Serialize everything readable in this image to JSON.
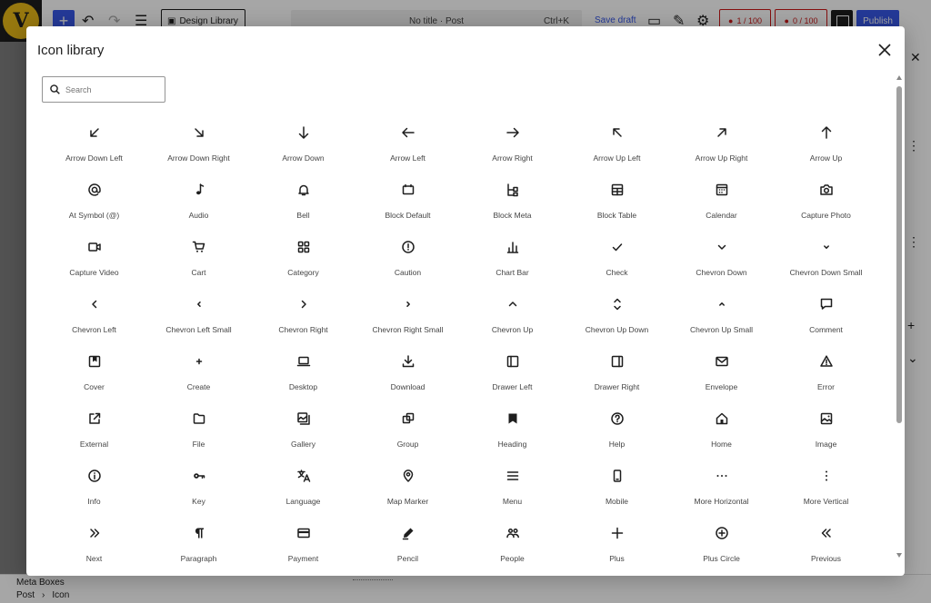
{
  "toolbar": {
    "design_library_label": "Design Library",
    "document_title": "No title · Post",
    "shortcut": "Ctrl+K",
    "save_draft": "Save draft",
    "score_readability": "1 / 100",
    "score_seo": "0 / 100",
    "publish": "Publish"
  },
  "modal": {
    "title": "Icon library",
    "search_placeholder": "Search",
    "icons": [
      {
        "label": "Arrow Down Left",
        "icon": "arrow-down-left"
      },
      {
        "label": "Arrow Down Right",
        "icon": "arrow-down-right"
      },
      {
        "label": "Arrow Down",
        "icon": "arrow-down"
      },
      {
        "label": "Arrow Left",
        "icon": "arrow-left"
      },
      {
        "label": "Arrow Right",
        "icon": "arrow-right"
      },
      {
        "label": "Arrow Up Left",
        "icon": "arrow-up-left"
      },
      {
        "label": "Arrow Up Right",
        "icon": "arrow-up-right"
      },
      {
        "label": "Arrow Up",
        "icon": "arrow-up"
      },
      {
        "label": "At Symbol (@)",
        "icon": "at-symbol"
      },
      {
        "label": "Audio",
        "icon": "audio"
      },
      {
        "label": "Bell",
        "icon": "bell"
      },
      {
        "label": "Block Default",
        "icon": "block-default"
      },
      {
        "label": "Block Meta",
        "icon": "block-meta"
      },
      {
        "label": "Block Table",
        "icon": "block-table"
      },
      {
        "label": "Calendar",
        "icon": "calendar"
      },
      {
        "label": "Capture Photo",
        "icon": "capture-photo"
      },
      {
        "label": "Capture Video",
        "icon": "capture-video"
      },
      {
        "label": "Cart",
        "icon": "cart"
      },
      {
        "label": "Category",
        "icon": "category"
      },
      {
        "label": "Caution",
        "icon": "caution"
      },
      {
        "label": "Chart Bar",
        "icon": "chart-bar"
      },
      {
        "label": "Check",
        "icon": "check"
      },
      {
        "label": "Chevron Down",
        "icon": "chevron-down"
      },
      {
        "label": "Chevron Down Small",
        "icon": "chevron-down-small"
      },
      {
        "label": "Chevron Left",
        "icon": "chevron-left"
      },
      {
        "label": "Chevron Left Small",
        "icon": "chevron-left-small"
      },
      {
        "label": "Chevron Right",
        "icon": "chevron-right"
      },
      {
        "label": "Chevron Right Small",
        "icon": "chevron-right-small"
      },
      {
        "label": "Chevron Up",
        "icon": "chevron-up"
      },
      {
        "label": "Chevron Up Down",
        "icon": "chevron-up-down"
      },
      {
        "label": "Chevron Up Small",
        "icon": "chevron-up-small"
      },
      {
        "label": "Comment",
        "icon": "comment"
      },
      {
        "label": "Cover",
        "icon": "cover"
      },
      {
        "label": "Create",
        "icon": "create"
      },
      {
        "label": "Desktop",
        "icon": "desktop"
      },
      {
        "label": "Download",
        "icon": "download"
      },
      {
        "label": "Drawer Left",
        "icon": "drawer-left"
      },
      {
        "label": "Drawer Right",
        "icon": "drawer-right"
      },
      {
        "label": "Envelope",
        "icon": "envelope"
      },
      {
        "label": "Error",
        "icon": "error"
      },
      {
        "label": "External",
        "icon": "external"
      },
      {
        "label": "File",
        "icon": "file"
      },
      {
        "label": "Gallery",
        "icon": "gallery"
      },
      {
        "label": "Group",
        "icon": "group"
      },
      {
        "label": "Heading",
        "icon": "heading"
      },
      {
        "label": "Help",
        "icon": "help"
      },
      {
        "label": "Home",
        "icon": "home"
      },
      {
        "label": "Image",
        "icon": "image"
      },
      {
        "label": "Info",
        "icon": "info"
      },
      {
        "label": "Key",
        "icon": "key"
      },
      {
        "label": "Language",
        "icon": "language"
      },
      {
        "label": "Map Marker",
        "icon": "map-marker"
      },
      {
        "label": "Menu",
        "icon": "menu"
      },
      {
        "label": "Mobile",
        "icon": "mobile"
      },
      {
        "label": "More Horizontal",
        "icon": "more-horizontal"
      },
      {
        "label": "More Vertical",
        "icon": "more-vertical"
      },
      {
        "label": "Next",
        "icon": "next"
      },
      {
        "label": "Paragraph",
        "icon": "paragraph"
      },
      {
        "label": "Payment",
        "icon": "payment"
      },
      {
        "label": "Pencil",
        "icon": "pencil"
      },
      {
        "label": "People",
        "icon": "people"
      },
      {
        "label": "Plus",
        "icon": "plus"
      },
      {
        "label": "Plus Circle",
        "icon": "plus-circle"
      },
      {
        "label": "Previous",
        "icon": "previous"
      }
    ]
  },
  "footer": {
    "meta_boxes": "Meta Boxes",
    "breadcrumb": [
      "Post",
      "›",
      "Icon"
    ]
  }
}
